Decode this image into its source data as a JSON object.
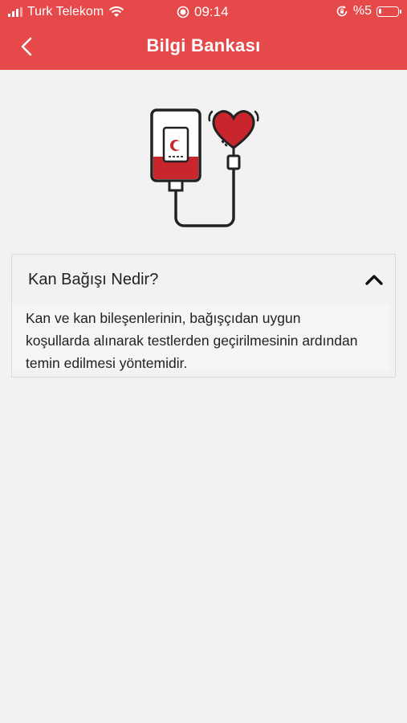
{
  "status_bar": {
    "carrier": "Turk Telekom",
    "time": "09:14",
    "battery_text": "%5"
  },
  "header": {
    "title": "Bilgi Bankası",
    "back_icon": "chevron-left-icon"
  },
  "illustration": {
    "icon": "blood-bag-heart-icon"
  },
  "accordion": {
    "title": "Kan Bağışı Nedir?",
    "body": "Kan ve kan bileşenlerinin, bağışçıdan uygun koşullarda alınarak testlerden geçirilmesinin ardından temin edilmesi yöntemidir.",
    "expanded": true
  },
  "colors": {
    "brand": "#e5494a",
    "blood": "#c9252c",
    "background": "#f2f2f2"
  }
}
